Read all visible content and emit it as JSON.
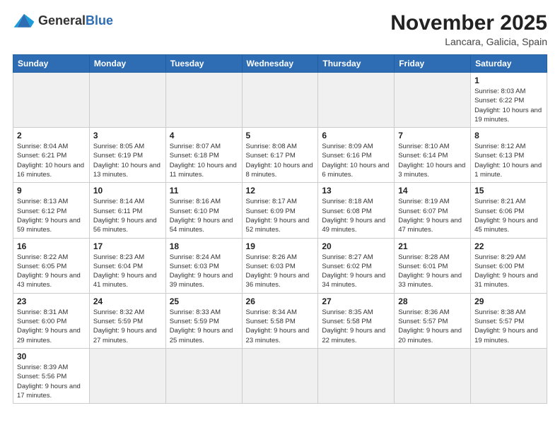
{
  "header": {
    "logo_general": "General",
    "logo_blue": "Blue",
    "month_title": "November 2025",
    "location": "Lancara, Galicia, Spain"
  },
  "weekdays": [
    "Sunday",
    "Monday",
    "Tuesday",
    "Wednesday",
    "Thursday",
    "Friday",
    "Saturday"
  ],
  "weeks": [
    [
      {
        "day": "",
        "info": ""
      },
      {
        "day": "",
        "info": ""
      },
      {
        "day": "",
        "info": ""
      },
      {
        "day": "",
        "info": ""
      },
      {
        "day": "",
        "info": ""
      },
      {
        "day": "",
        "info": ""
      },
      {
        "day": "1",
        "info": "Sunrise: 8:03 AM\nSunset: 6:22 PM\nDaylight: 10 hours and 19 minutes."
      }
    ],
    [
      {
        "day": "2",
        "info": "Sunrise: 8:04 AM\nSunset: 6:21 PM\nDaylight: 10 hours and 16 minutes."
      },
      {
        "day": "3",
        "info": "Sunrise: 8:05 AM\nSunset: 6:19 PM\nDaylight: 10 hours and 13 minutes."
      },
      {
        "day": "4",
        "info": "Sunrise: 8:07 AM\nSunset: 6:18 PM\nDaylight: 10 hours and 11 minutes."
      },
      {
        "day": "5",
        "info": "Sunrise: 8:08 AM\nSunset: 6:17 PM\nDaylight: 10 hours and 8 minutes."
      },
      {
        "day": "6",
        "info": "Sunrise: 8:09 AM\nSunset: 6:16 PM\nDaylight: 10 hours and 6 minutes."
      },
      {
        "day": "7",
        "info": "Sunrise: 8:10 AM\nSunset: 6:14 PM\nDaylight: 10 hours and 3 minutes."
      },
      {
        "day": "8",
        "info": "Sunrise: 8:12 AM\nSunset: 6:13 PM\nDaylight: 10 hours and 1 minute."
      }
    ],
    [
      {
        "day": "9",
        "info": "Sunrise: 8:13 AM\nSunset: 6:12 PM\nDaylight: 9 hours and 59 minutes."
      },
      {
        "day": "10",
        "info": "Sunrise: 8:14 AM\nSunset: 6:11 PM\nDaylight: 9 hours and 56 minutes."
      },
      {
        "day": "11",
        "info": "Sunrise: 8:16 AM\nSunset: 6:10 PM\nDaylight: 9 hours and 54 minutes."
      },
      {
        "day": "12",
        "info": "Sunrise: 8:17 AM\nSunset: 6:09 PM\nDaylight: 9 hours and 52 minutes."
      },
      {
        "day": "13",
        "info": "Sunrise: 8:18 AM\nSunset: 6:08 PM\nDaylight: 9 hours and 49 minutes."
      },
      {
        "day": "14",
        "info": "Sunrise: 8:19 AM\nSunset: 6:07 PM\nDaylight: 9 hours and 47 minutes."
      },
      {
        "day": "15",
        "info": "Sunrise: 8:21 AM\nSunset: 6:06 PM\nDaylight: 9 hours and 45 minutes."
      }
    ],
    [
      {
        "day": "16",
        "info": "Sunrise: 8:22 AM\nSunset: 6:05 PM\nDaylight: 9 hours and 43 minutes."
      },
      {
        "day": "17",
        "info": "Sunrise: 8:23 AM\nSunset: 6:04 PM\nDaylight: 9 hours and 41 minutes."
      },
      {
        "day": "18",
        "info": "Sunrise: 8:24 AM\nSunset: 6:03 PM\nDaylight: 9 hours and 39 minutes."
      },
      {
        "day": "19",
        "info": "Sunrise: 8:26 AM\nSunset: 6:03 PM\nDaylight: 9 hours and 36 minutes."
      },
      {
        "day": "20",
        "info": "Sunrise: 8:27 AM\nSunset: 6:02 PM\nDaylight: 9 hours and 34 minutes."
      },
      {
        "day": "21",
        "info": "Sunrise: 8:28 AM\nSunset: 6:01 PM\nDaylight: 9 hours and 33 minutes."
      },
      {
        "day": "22",
        "info": "Sunrise: 8:29 AM\nSunset: 6:00 PM\nDaylight: 9 hours and 31 minutes."
      }
    ],
    [
      {
        "day": "23",
        "info": "Sunrise: 8:31 AM\nSunset: 6:00 PM\nDaylight: 9 hours and 29 minutes."
      },
      {
        "day": "24",
        "info": "Sunrise: 8:32 AM\nSunset: 5:59 PM\nDaylight: 9 hours and 27 minutes."
      },
      {
        "day": "25",
        "info": "Sunrise: 8:33 AM\nSunset: 5:59 PM\nDaylight: 9 hours and 25 minutes."
      },
      {
        "day": "26",
        "info": "Sunrise: 8:34 AM\nSunset: 5:58 PM\nDaylight: 9 hours and 23 minutes."
      },
      {
        "day": "27",
        "info": "Sunrise: 8:35 AM\nSunset: 5:58 PM\nDaylight: 9 hours and 22 minutes."
      },
      {
        "day": "28",
        "info": "Sunrise: 8:36 AM\nSunset: 5:57 PM\nDaylight: 9 hours and 20 minutes."
      },
      {
        "day": "29",
        "info": "Sunrise: 8:38 AM\nSunset: 5:57 PM\nDaylight: 9 hours and 19 minutes."
      }
    ],
    [
      {
        "day": "30",
        "info": "Sunrise: 8:39 AM\nSunset: 5:56 PM\nDaylight: 9 hours and 17 minutes."
      },
      {
        "day": "",
        "info": ""
      },
      {
        "day": "",
        "info": ""
      },
      {
        "day": "",
        "info": ""
      },
      {
        "day": "",
        "info": ""
      },
      {
        "day": "",
        "info": ""
      },
      {
        "day": "",
        "info": ""
      }
    ]
  ]
}
